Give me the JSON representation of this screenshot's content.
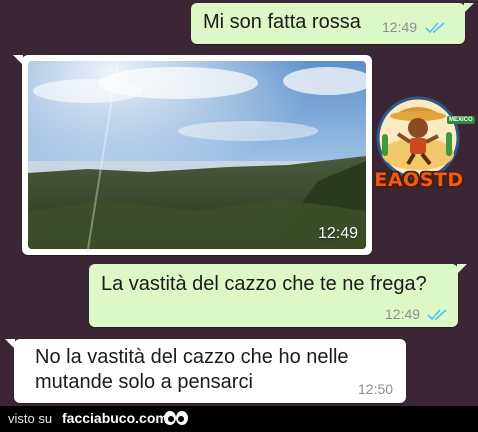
{
  "messages": [
    {
      "text": "Mi son fatta rossa",
      "time": "12:49"
    },
    {
      "time": "12:49"
    },
    {
      "text": "La vastità del cazzo che te ne frega?",
      "time": "12:49"
    },
    {
      "text": "No la vastità del cazzo che ho nelle\nmutande solo a pensarci",
      "time": "12:50"
    }
  ],
  "logo": {
    "text": "EAOSTD",
    "badge": "MEXICO"
  },
  "footer": {
    "visto": "visto su",
    "site": "facciabuco.com"
  },
  "colors": {
    "background": "#3a2634",
    "outgoing_bubble": "#dcf8c6",
    "incoming_bubble": "#ffffff",
    "read_ticks": "#4fc3f7"
  }
}
